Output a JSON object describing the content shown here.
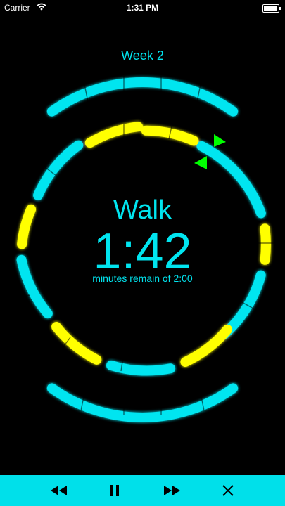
{
  "status_bar": {
    "carrier": "Carrier",
    "time": "1:31 PM",
    "icons": [
      "wifi-icon",
      "battery-icon"
    ]
  },
  "header": {
    "week_label": "Week 2"
  },
  "timer": {
    "mode": "Walk",
    "value": "1:42",
    "remain_text": "minutes remain of 2:00",
    "progress_fraction": 0.15
  },
  "colors": {
    "walk": "#00e5f0",
    "run": "#ffff00",
    "marker": "#00ff00",
    "background": "#000000",
    "toolbar": "#00e0ea"
  },
  "toolbar": {
    "buttons": [
      "rewind-icon",
      "pause-icon",
      "fast-forward-icon",
      "close-icon"
    ]
  }
}
